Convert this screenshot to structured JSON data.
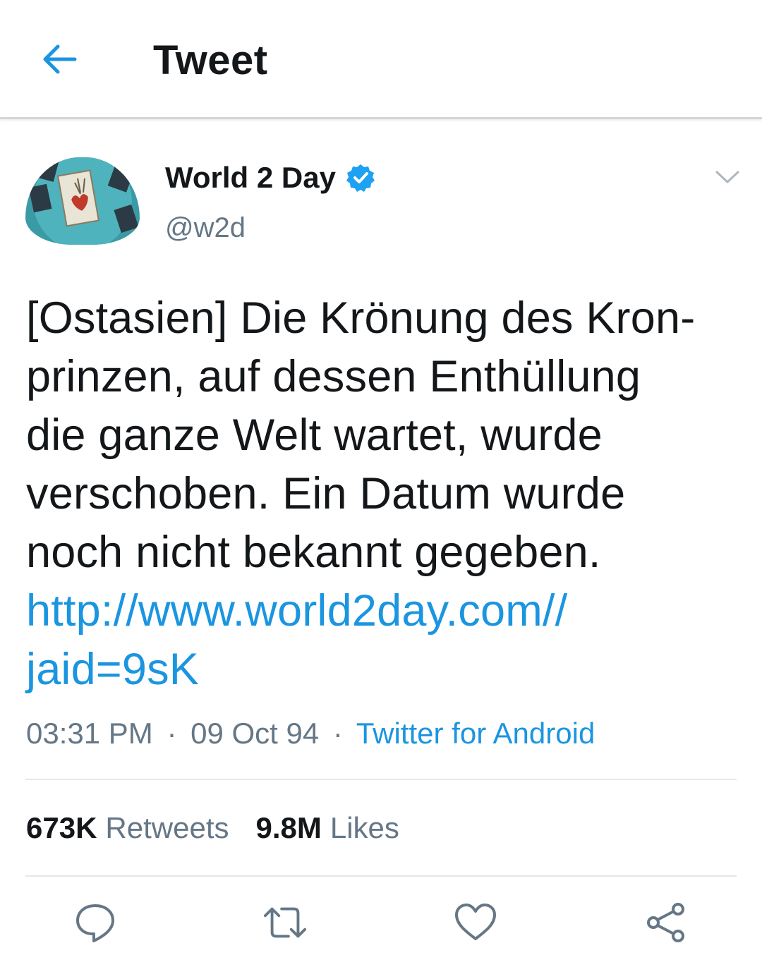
{
  "appbar": {
    "title": "Tweet",
    "back_icon": "arrow-left-icon"
  },
  "tweet": {
    "author_name": "World 2 Day",
    "author_handle": "@w2d",
    "verified_icon": "verified-badge-icon",
    "menu_icon": "chevron-down-icon",
    "text_lines": [
      "[Ostasien] Die Krönung des Kron-",
      "prinzen, auf dessen Enthüllung",
      "die ganze Welt wartet, wurde",
      "verschoben. Ein Datum wurde",
      "noch nicht bekannt gegeben."
    ],
    "link_lines": [
      "http://www.world2day.com//",
      "jaid=9sK"
    ],
    "time": "03:31 PM",
    "date": "09 Oct 94",
    "separator": "·",
    "source": "Twitter for Android"
  },
  "stats": {
    "retweets_count": "673K",
    "retweets_label": "Retweets",
    "likes_count": "9.8M",
    "likes_label": "Likes"
  },
  "actions": [
    {
      "name": "reply",
      "icon": "speech-bubble-icon"
    },
    {
      "name": "retweet",
      "icon": "retweet-icon"
    },
    {
      "name": "like",
      "icon": "heart-icon"
    },
    {
      "name": "share",
      "icon": "share-icon"
    }
  ],
  "colors": {
    "accent": "#1b95e0",
    "text": "#14171a",
    "secondary_text": "#657786",
    "divider": "#e1e8ed"
  }
}
